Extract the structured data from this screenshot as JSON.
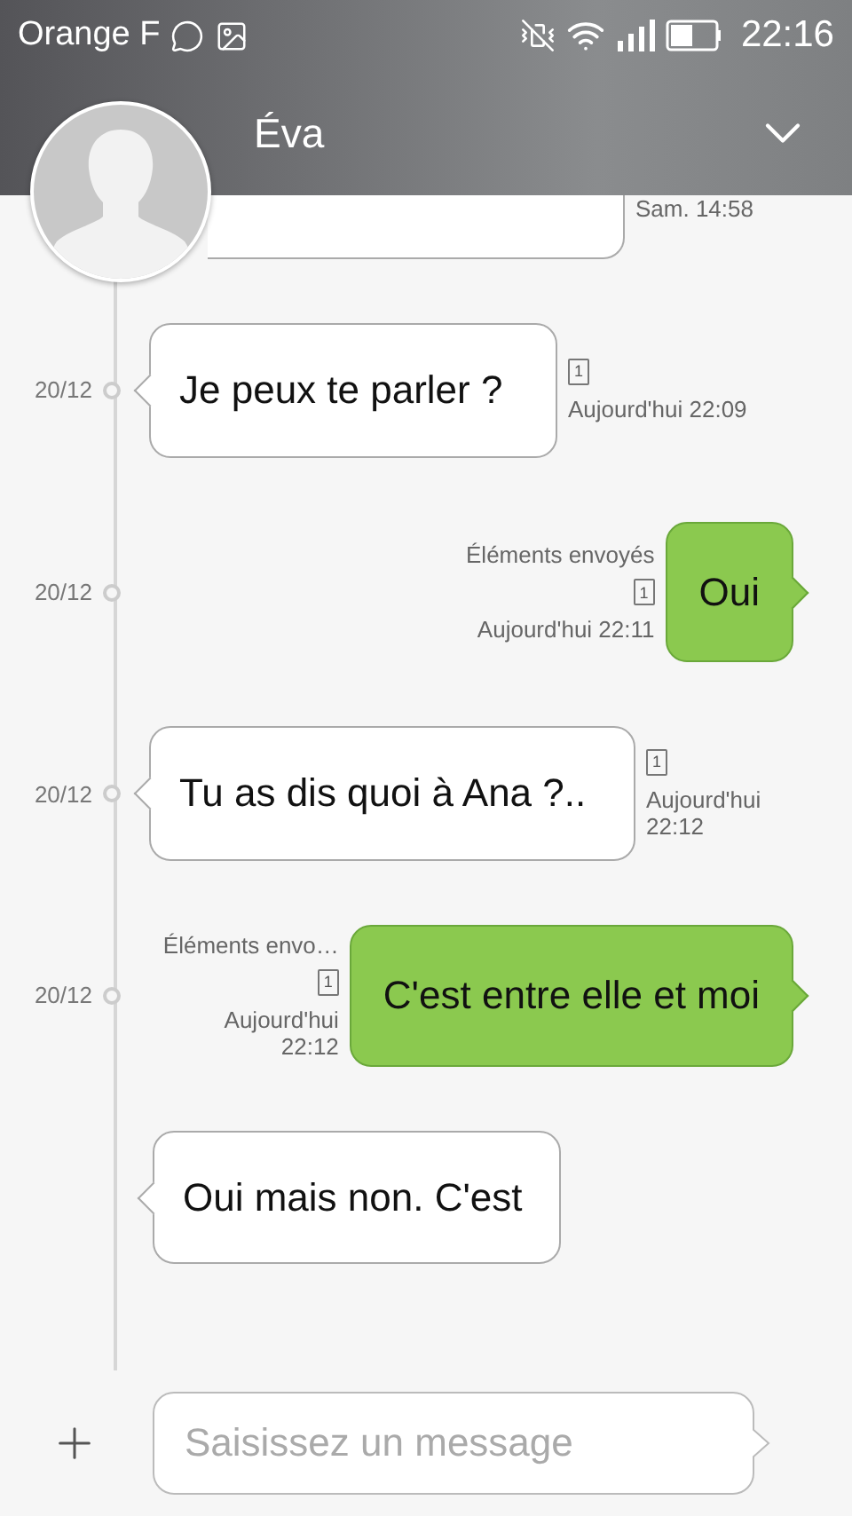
{
  "status_bar": {
    "carrier": "Orange F",
    "time": "22:16"
  },
  "header": {
    "contact_name": "Éva"
  },
  "messages": [
    {
      "kind": "partial",
      "time": "Sam. 14:58"
    },
    {
      "kind": "received",
      "date": "20/12",
      "text": "Je peux te parler ?",
      "sim": "1",
      "time": "Aujourd'hui 22:09"
    },
    {
      "kind": "sent",
      "date": "20/12",
      "status": "Éléments envoyés",
      "text": "Oui",
      "sim": "1",
      "time": "Aujourd'hui 22:11"
    },
    {
      "kind": "received",
      "date": "20/12",
      "text": "Tu as dis quoi à Ana ?..",
      "sim": "1",
      "time": "Aujourd'hui 22:12"
    },
    {
      "kind": "sent",
      "date": "20/12",
      "status": "Éléments envo…",
      "text": "C'est entre elle et moi",
      "sim": "1",
      "time": "Aujourd'hui 22:12"
    },
    {
      "kind": "received",
      "text": "Oui mais non. C'est"
    }
  ],
  "composer": {
    "placeholder": "Saisissez un message"
  }
}
